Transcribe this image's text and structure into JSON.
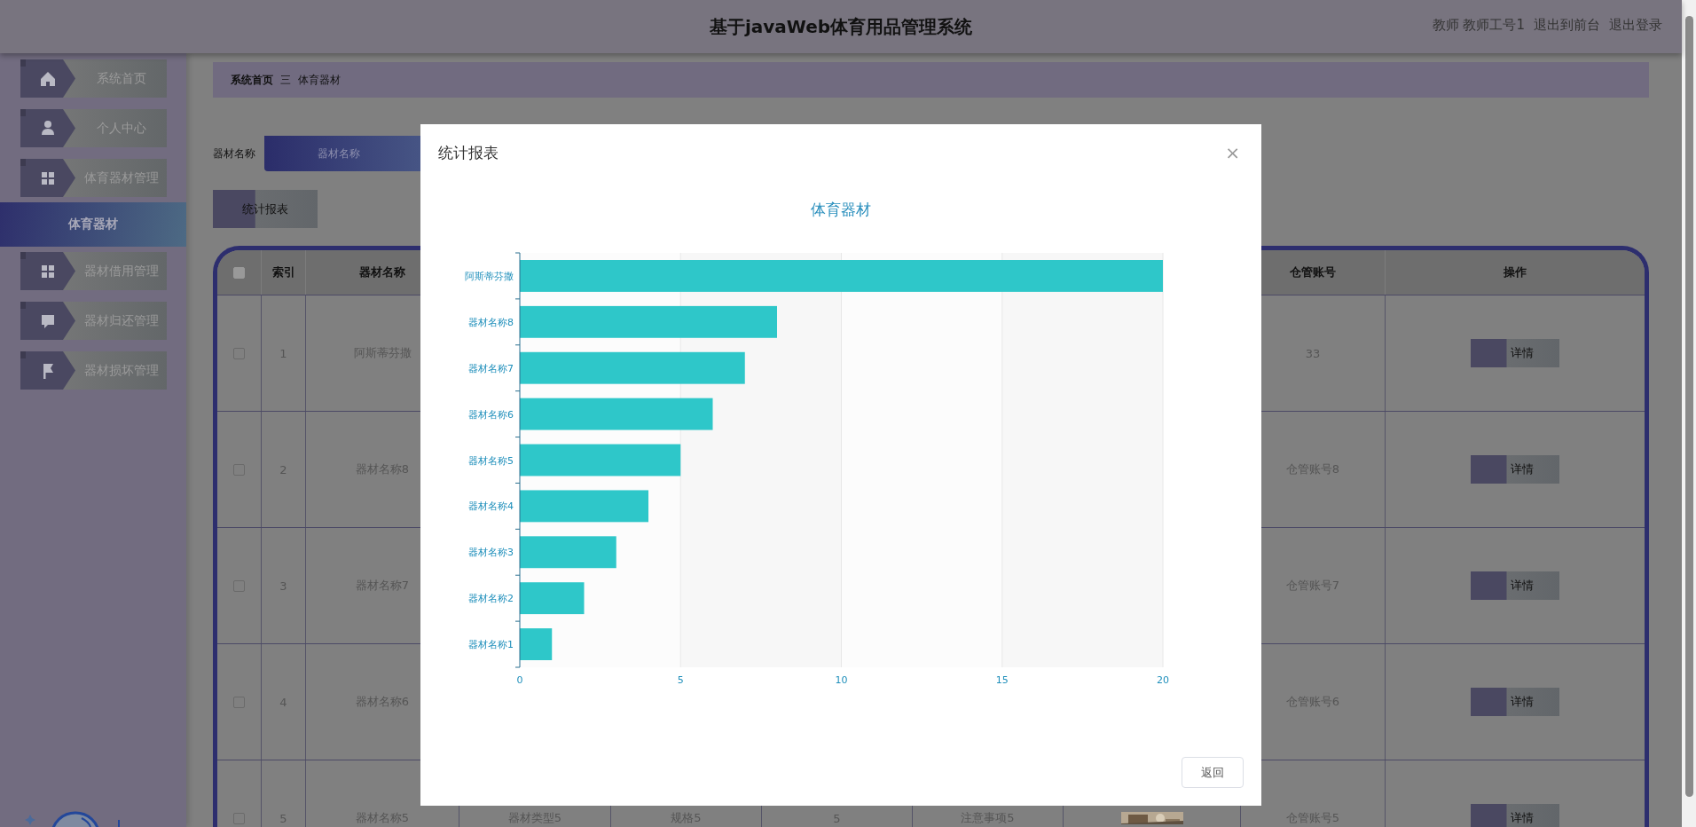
{
  "header": {
    "title": "基于javaWeb体育用品管理系统",
    "user": "教师 教师工号1",
    "links": [
      "退出到前台",
      "退出登录"
    ]
  },
  "sidebar": {
    "items": [
      {
        "label": "系统首页",
        "selected": false
      },
      {
        "label": "个人中心",
        "selected": false
      },
      {
        "label": "体育器材管理",
        "selected": false
      },
      {
        "label": "体育器材",
        "selected": true
      },
      {
        "label": "器材借用管理",
        "selected": false
      },
      {
        "label": "器材归还管理",
        "selected": false
      },
      {
        "label": "器材损坏管理",
        "selected": false
      }
    ]
  },
  "breadcrumb": [
    "系统首页",
    "三",
    "体育器材"
  ],
  "search": {
    "label": "器材名称",
    "placeholder": "器材名称"
  },
  "report_button": "统计报表",
  "table": {
    "header_checkbox": {
      "checked": false
    },
    "columns": {
      "index": "索引",
      "name": "器材名称",
      "warehouse_account": "仓管账号",
      "action": "操作"
    },
    "rows": [
      {
        "checked": false,
        "index": "1",
        "name": "阿斯蒂芬撒",
        "warehouse_account": "33",
        "action": "详情"
      },
      {
        "checked": false,
        "index": "2",
        "name": "器材名称8",
        "warehouse_account": "仓管账号8",
        "action": "详情"
      },
      {
        "checked": false,
        "index": "3",
        "name": "器材名称7",
        "warehouse_account": "仓管账号7",
        "action": "详情"
      },
      {
        "checked": false,
        "index": "4",
        "name": "器材名称6",
        "warehouse_account": "仓管账号6",
        "action": "详情"
      },
      {
        "checked": false,
        "index": "5",
        "name": "器材名称5",
        "column_4": "器材类型5",
        "column_5": "规格5",
        "column_6": "5",
        "column_7": "注意事项5",
        "warehouse_account": "仓管账号5",
        "action": "详情"
      }
    ]
  },
  "dialog": {
    "title": "统计报表",
    "close": "×",
    "button": "返回",
    "chart_data": {
      "type": "bar",
      "orientation": "horizontal",
      "title": "体育器材",
      "categories": [
        "阿斯蒂芬撒",
        "器材名称8",
        "器材名称7",
        "器材名称6",
        "器材名称5",
        "器材名称4",
        "器材名称3",
        "器材名称2",
        "器材名称1"
      ],
      "series": [
        {
          "color": "#2ec7c9",
          "values": [
            20,
            8,
            7,
            6,
            5,
            4,
            3,
            2,
            1
          ]
        }
      ],
      "xlim": [
        0,
        20
      ],
      "xticks": [
        0,
        5,
        10,
        15,
        20
      ],
      "grid": true
    }
  }
}
